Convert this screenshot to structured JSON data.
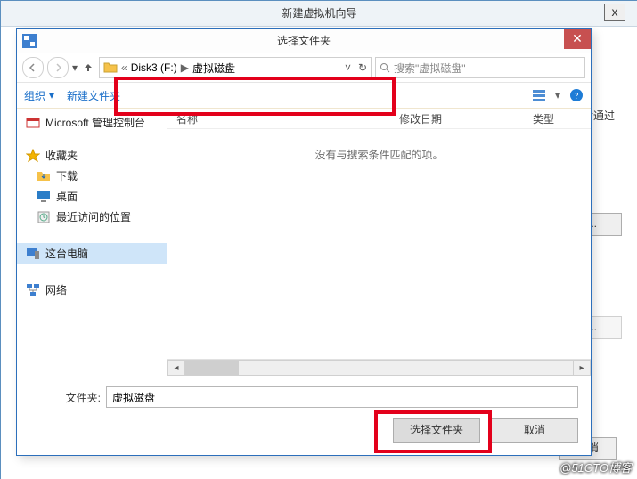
{
  "wizard": {
    "title": "新建虚拟机向导",
    "close_glyph": "x",
    "hint_fragment": "肖后通过",
    "btn_b_label": "B)...",
    "btn_browse_disabled": "B)...",
    "btn_cancel_back": "取消"
  },
  "dialog": {
    "title": "选择文件夹",
    "close_glyph": "✕"
  },
  "nav": {
    "crumb_prefix": "«",
    "crumb_drive": "Disk3 (F:)",
    "crumb_sep": "▶",
    "crumb_folder": "虚拟磁盘",
    "drop_glyph": "˅",
    "reload_glyph": "↻",
    "search_placeholder": "搜索\"虚拟磁盘\""
  },
  "toolbar": {
    "organize": "组织",
    "organize_drop": "▾",
    "new_folder": "新建文件夹"
  },
  "columns": {
    "name": "名称",
    "date": "修改日期",
    "type": "类型"
  },
  "sidebar": {
    "items": [
      {
        "label": "Microsoft 管理控制台",
        "icon": "mmc",
        "root": true
      },
      {
        "label": "收藏夹",
        "icon": "star",
        "root": true,
        "header": true
      },
      {
        "label": "下载",
        "icon": "download"
      },
      {
        "label": "桌面",
        "icon": "desktop"
      },
      {
        "label": "最近访问的位置",
        "icon": "recent"
      },
      {
        "label": "这台电脑",
        "icon": "pc",
        "root": true,
        "selected": true
      },
      {
        "label": "网络",
        "icon": "network",
        "root": true
      }
    ]
  },
  "empty_text": "没有与搜索条件匹配的项。",
  "folder_field": {
    "label": "文件夹:",
    "value": "虚拟磁盘"
  },
  "buttons": {
    "select": "选择文件夹",
    "cancel": "取消"
  },
  "watermark": "@51CTO博客"
}
